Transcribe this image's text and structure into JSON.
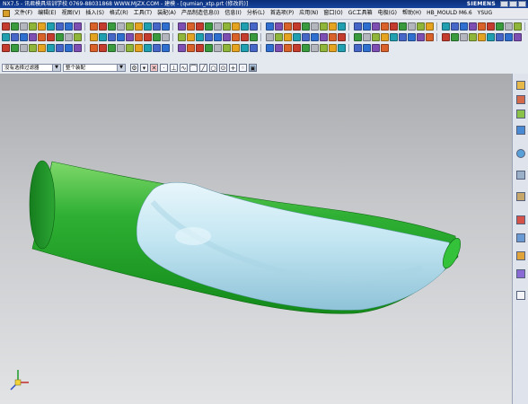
{
  "window": {
    "title": "NX7.5 - 讯君模具培训学校 0769-88031868 WWW.MJZX.COM - 建模 - [qumian_xtp.prt (修改的)]",
    "brand": "SIEMENS"
  },
  "menu": {
    "items": [
      "文件(F)",
      "编辑(E)",
      "视图(V)",
      "插入(S)",
      "格式(R)",
      "工具(T)",
      "装配(A)",
      "产品制造信息(I)",
      "信息(I)",
      "分析(L)",
      "首选项(P)",
      "应用(N)",
      "窗口(O)",
      "GC工具箱",
      "电极(G)",
      "帮助(H)",
      "HB_MOULD M6.6",
      "YSUG"
    ]
  },
  "toolbar": {
    "icon_colors": [
      "#c43c2e",
      "#2f6fd0",
      "#e4a321",
      "#3a9a3e",
      "#7d4fb3",
      "#1f9fb0",
      "#b3b6bd",
      "#d9622b",
      "#4667c8",
      "#8fb53a"
    ]
  },
  "selection": {
    "filter_value": "没有选择过滤器",
    "scope_value": "整个装配",
    "icons": [
      "snap-icon",
      "point-icon",
      "line-icon",
      "curve-icon",
      "circle-icon",
      "plus-icon",
      "arc-icon",
      "box-icon"
    ]
  },
  "colors": {
    "model_green": "#2fb034",
    "model_blue": "#c3e6f2",
    "viewport_top": "#a9abae",
    "viewport_bottom": "#e2e3e5"
  },
  "resource_bar": {
    "icons": [
      "assembly-navigator-icon",
      "constraint-navigator-icon",
      "part-navigator-icon",
      "reuse-library-icon",
      "history-icon",
      "web-browser-icon",
      "role-icon",
      "system-materials-icon",
      "process-studio-icon",
      "manufacturing-wizard-icon",
      "roles-icon"
    ]
  }
}
